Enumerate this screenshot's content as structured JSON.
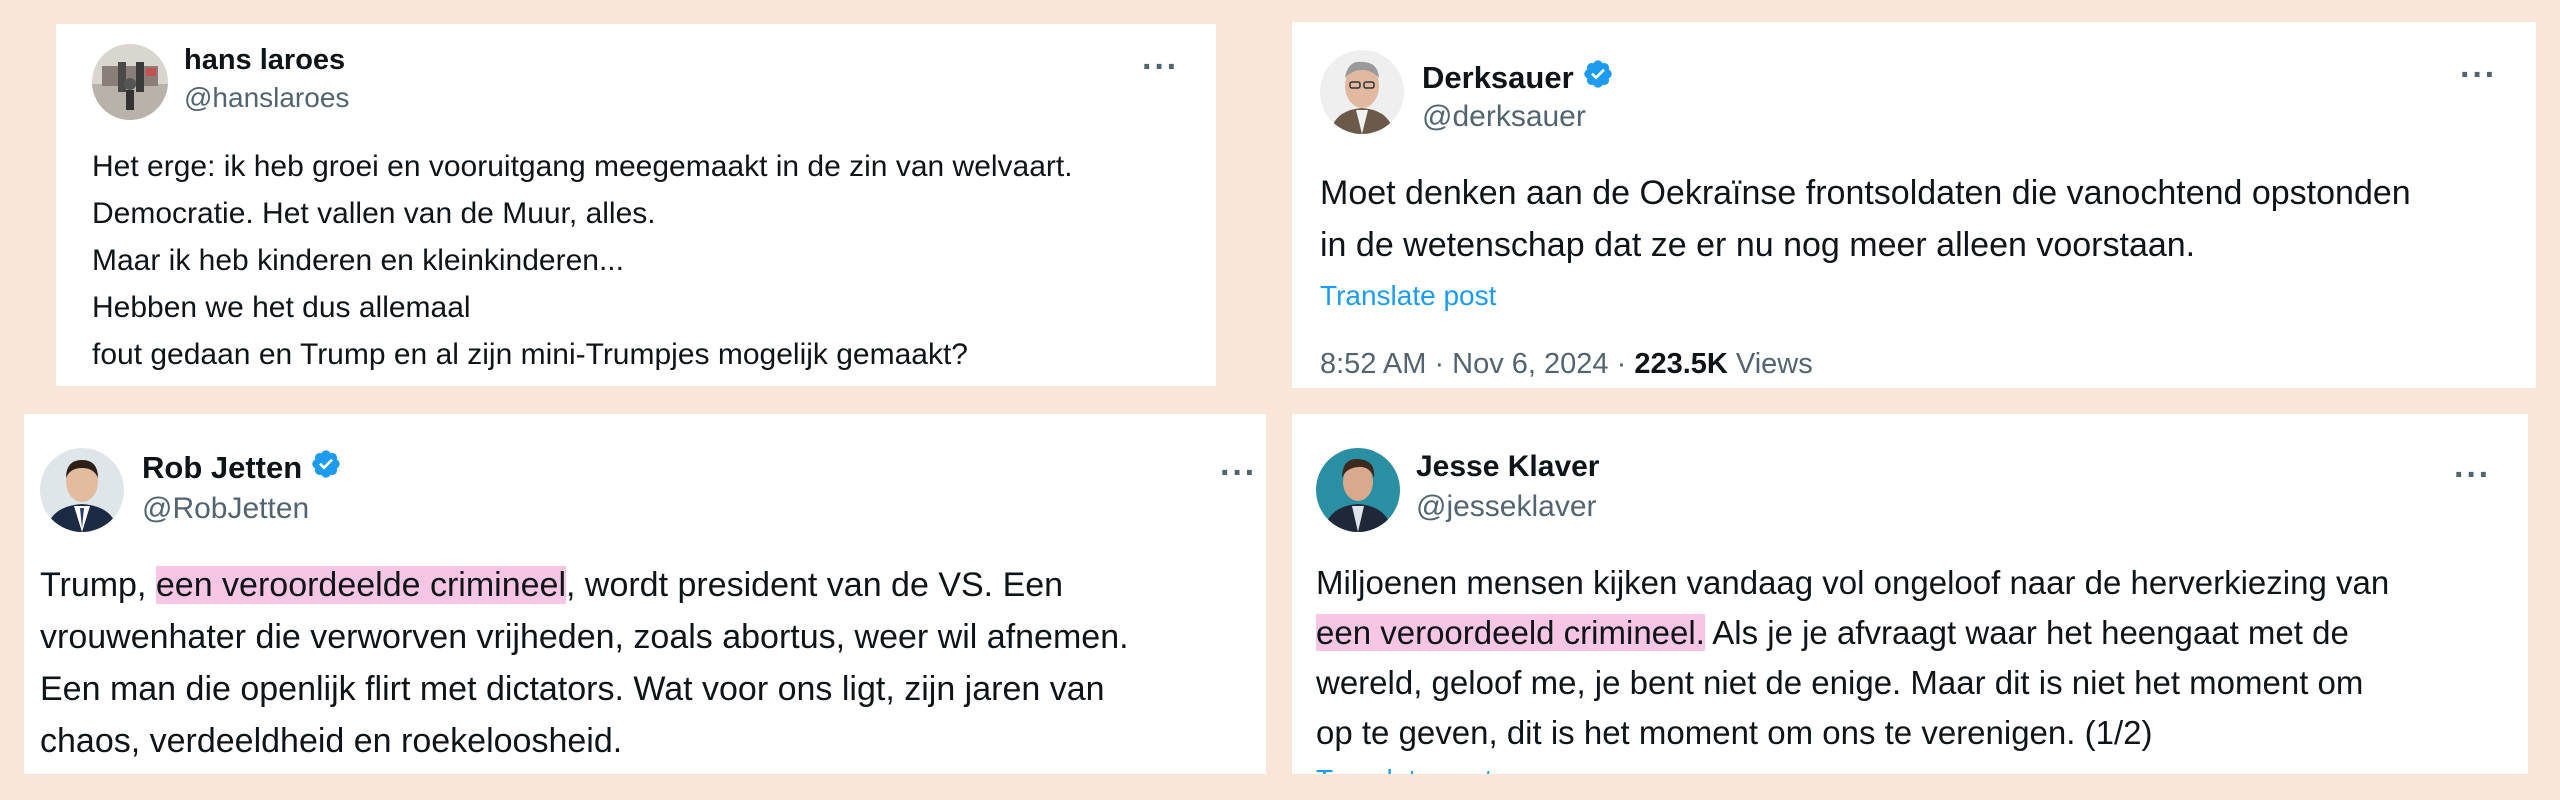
{
  "posts": [
    {
      "name": "hans laroes",
      "handle": "@hanslaroes",
      "verified": false,
      "lines": [
        "Het erge: ik heb groei en vooruitgang meegemaakt in de zin van welvaart.",
        "Democratie. Het vallen van de Muur, alles.",
        "Maar ik heb kinderen en kleinkinderen...",
        "Hebben we het dus allemaal",
        "fout gedaan en Trump en al zijn mini-Trumpjes mogelijk gemaakt?"
      ]
    },
    {
      "name": "Derksauer",
      "handle": "@derksauer",
      "verified": true,
      "lines": [
        "Moet denken aan de Oekraïnse frontsoldaten die vanochtend opstonden",
        "in de wetenschap dat ze er nu nog meer alleen voorstaan."
      ],
      "translate": "Translate post",
      "time": "8:52 AM · Nov 6, 2024 · ",
      "views_count": "223.5K",
      "views_label": " Views"
    },
    {
      "name": "Rob Jetten",
      "handle": "@RobJetten",
      "verified": true,
      "line1_pre": "Trump, ",
      "line1_hl": "een veroordeelde crimineel",
      "line1_post": ", wordt president van de VS. Een",
      "lines": [
        "vrouwenhater die verworven vrijheden, zoals abortus, weer wil afnemen.",
        "Een man die openlijk flirt met dictators. Wat voor ons ligt, zijn jaren van",
        "chaos, verdeeldheid en roekeloosheid."
      ]
    },
    {
      "name": "Jesse Klaver",
      "handle": "@jesseklaver",
      "verified": false,
      "line1": "Miljoenen mensen kijken vandaag vol ongeloof naar de herverkiezing van",
      "line2_hl": "een veroordeeld crimineel.",
      "line2_post": " Als je je afvraagt waar het heengaat met de",
      "lines": [
        "wereld, geloof me, je bent niet de enige. Maar dit is niet het moment om",
        "op te geven, dit is het moment om ons te verenigen. (1/2)"
      ],
      "translate": "Translate post"
    }
  ],
  "more_label": "···"
}
